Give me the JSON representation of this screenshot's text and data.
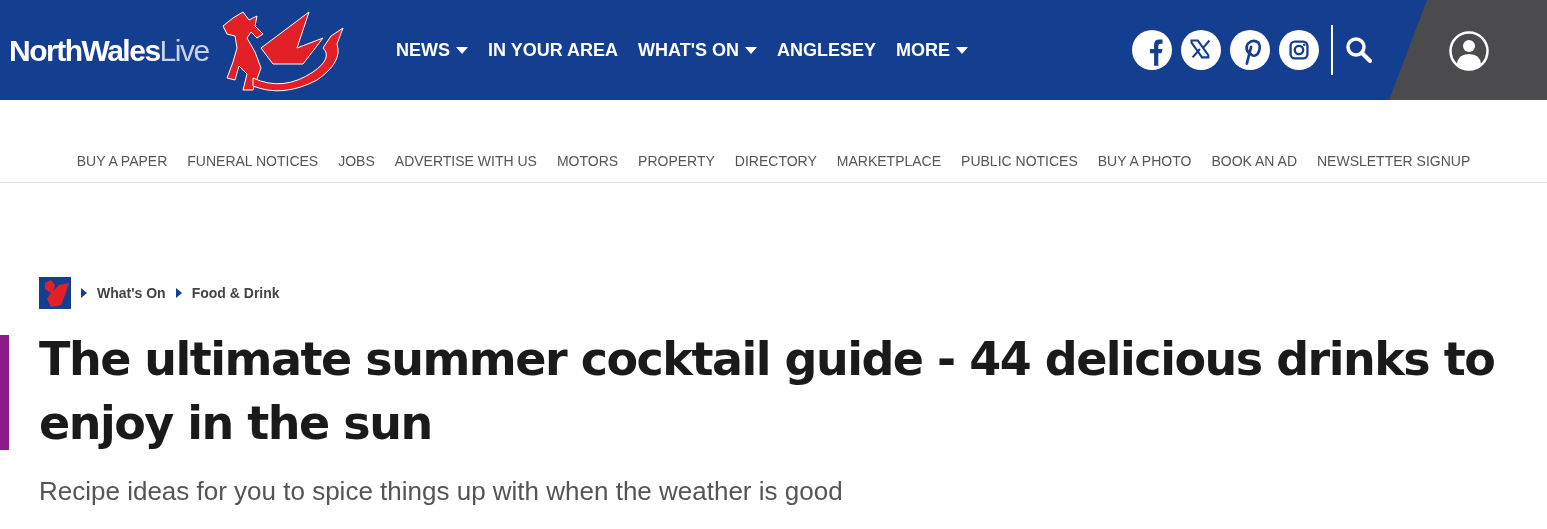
{
  "header": {
    "logo": {
      "primary": "NorthWales",
      "secondary": "Live"
    },
    "nav": [
      {
        "label": "NEWS",
        "has_menu": true
      },
      {
        "label": "IN YOUR AREA",
        "has_menu": false
      },
      {
        "label": "WHAT'S ON",
        "has_menu": true
      },
      {
        "label": "ANGLESEY",
        "has_menu": false
      },
      {
        "label": "MORE",
        "has_menu": true
      }
    ],
    "social": [
      {
        "kind": "facebook"
      },
      {
        "kind": "x"
      },
      {
        "kind": "pinterest"
      },
      {
        "kind": "instagram"
      }
    ]
  },
  "sub_nav": [
    "BUY A PAPER",
    "FUNERAL NOTICES",
    "JOBS",
    "ADVERTISE WITH US",
    "MOTORS",
    "PROPERTY",
    "DIRECTORY",
    "MARKETPLACE",
    "PUBLIC NOTICES",
    "BUY A PHOTO",
    "BOOK AN AD",
    "NEWSLETTER SIGNUP"
  ],
  "breadcrumb": [
    "What's On",
    "Food & Drink"
  ],
  "article": {
    "headline": "The ultimate summer cocktail guide - 44 delicious drinks to enjoy in the sun",
    "standfirst": "Recipe ideas for you to spice things up with when the weather is good"
  }
}
